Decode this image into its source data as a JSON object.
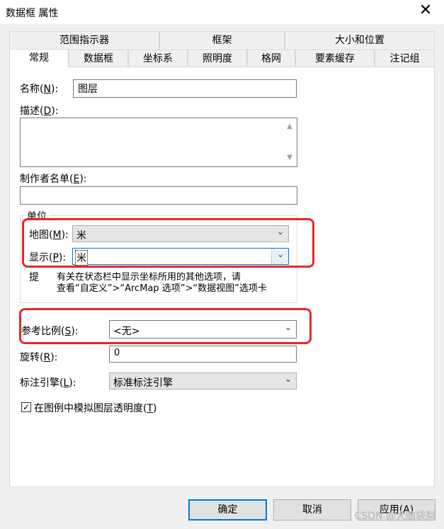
{
  "window": {
    "title": "数据框 属性",
    "close_glyph": "✕"
  },
  "tabs_row1": [
    {
      "label": "范围指示器"
    },
    {
      "label": "框架"
    },
    {
      "label": "大小和位置"
    }
  ],
  "tabs_row2": [
    {
      "label": "常规",
      "active": true
    },
    {
      "label": "数据框"
    },
    {
      "label": "坐标系"
    },
    {
      "label": "照明度"
    },
    {
      "label": "格网"
    },
    {
      "label": "要素缓存"
    },
    {
      "label": "注记组"
    }
  ],
  "general": {
    "name": {
      "label": "名称(",
      "key": "N",
      "label_end": "):",
      "value": "图层"
    },
    "description": {
      "label": "描述(",
      "key": "D",
      "label_end": "):",
      "value": ""
    },
    "credits": {
      "label": "制作者名单(",
      "key": "E",
      "label_end": "):",
      "value": ""
    },
    "units": {
      "group_title": "单位",
      "map": {
        "label": "地图(",
        "key": "M",
        "label_end": "):",
        "value": "米"
      },
      "display": {
        "label": "显示(",
        "key": "P",
        "label_end": "):",
        "value": "米"
      },
      "tip_prefix": "提",
      "tip_line1": "有关在状态栏中显示坐标所用的其他选项，请",
      "tip_line2": "查看“自定义”>“ArcMap 选项”>“数据视图”选项卡"
    },
    "reference_scale": {
      "label": "参考比例(",
      "key": "S",
      "label_end": "):",
      "value": "<无>"
    },
    "rotation": {
      "label": "旋转(",
      "key": "R",
      "label_end": "):",
      "value": "0"
    },
    "label_engine": {
      "label": "标注引擎(",
      "key": "L",
      "label_end": "):",
      "value": "标准标注引擎"
    },
    "simulate_transparency": {
      "label": "在图例中模拟图层透明度(",
      "key": "T",
      "label_end": ")",
      "checked": true,
      "check_glyph": "✓"
    }
  },
  "buttons": {
    "ok": "确定",
    "cancel": "取消",
    "apply": "应用(A)"
  },
  "watermark": "CSDN @大脑袋梨",
  "colors": {
    "highlight": "#e8272a",
    "focus": "#0078d7"
  }
}
